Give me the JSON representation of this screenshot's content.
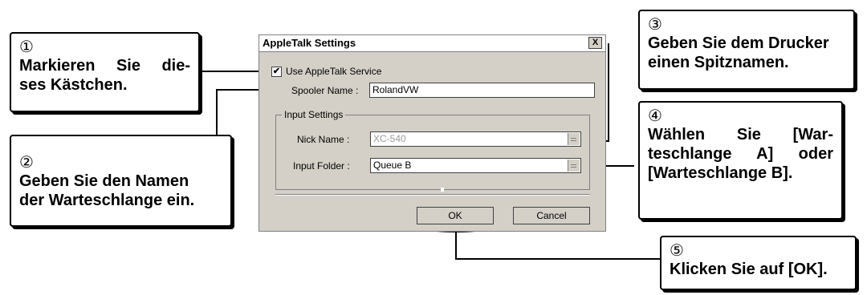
{
  "dialog": {
    "title": "AppleTalk Settings",
    "close_glyph": "X",
    "checkbox_label": "Use AppleTalk Service",
    "checkbox_checked": true,
    "spooler_label": "Spooler Name :",
    "spooler_value": "RolandVW",
    "group_label": "Input Settings",
    "nick_label": "Nick Name :",
    "nick_value": "XC-540",
    "folder_label": "Input Folder :",
    "folder_value": "Queue B",
    "ok_label": "OK",
    "cancel_label": "Cancel"
  },
  "callouts": [
    {
      "num": "①",
      "text": "Markieren Sie die-ses Kästchen."
    },
    {
      "num": "②",
      "text": "Geben Sie den Namen der Warteschlange ein."
    },
    {
      "num": "③",
      "text": "Geben Sie dem Drucker einen Spitznamen."
    },
    {
      "num": "④",
      "text": "Wählen Sie [Warteschlange A] oder [Warteschlange B]."
    },
    {
      "num": "⑤",
      "text": "Klicken Sie auf [OK]."
    }
  ],
  "callout_lines": {
    "c1": [
      "Markieren Sie die-",
      "ses Kästchen."
    ],
    "c2": [
      "Geben Sie den Namen",
      "der Warteschlange ein."
    ],
    "c3": [
      "Geben Sie dem Drucker",
      "einen Spitznamen."
    ],
    "c4": [
      "Wählen Sie [War-",
      "teschlange A] oder",
      "[Warteschlange B]."
    ],
    "c5": [
      "Klicken Sie auf [OK]."
    ]
  }
}
